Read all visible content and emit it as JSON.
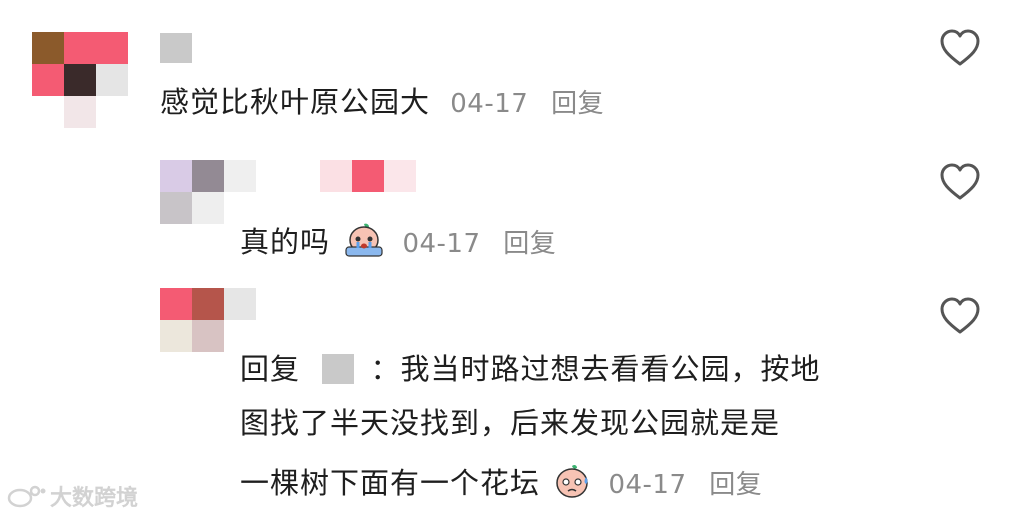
{
  "comments": [
    {
      "text": "感觉比秋叶原公园大",
      "date": "04-17",
      "reply_label": "回复"
    },
    {
      "text": "真的吗",
      "date": "04-17",
      "reply_label": "回复"
    },
    {
      "reply_prefix": "回复",
      "reply_colon": "：",
      "text_line1": "我当时路过想去看看公园，按地",
      "text_line2": "图找了半天没找到，后来发现公园就是是",
      "text_line3": "一棵树下面有一个花坛",
      "date": "04-17",
      "reply_label": "回复"
    }
  ],
  "icons": {
    "like": "heart-outline-icon",
    "emoji_crying": "crying-emoji-icon",
    "emoji_sweat": "sweat-emoji-icon",
    "watermark_logo": "weibo-logo-icon"
  },
  "watermark": {
    "text": "大数跨境"
  },
  "colors": {
    "text": "#1e1e1e",
    "meta": "#8a8a8a",
    "heart": "#555555"
  }
}
